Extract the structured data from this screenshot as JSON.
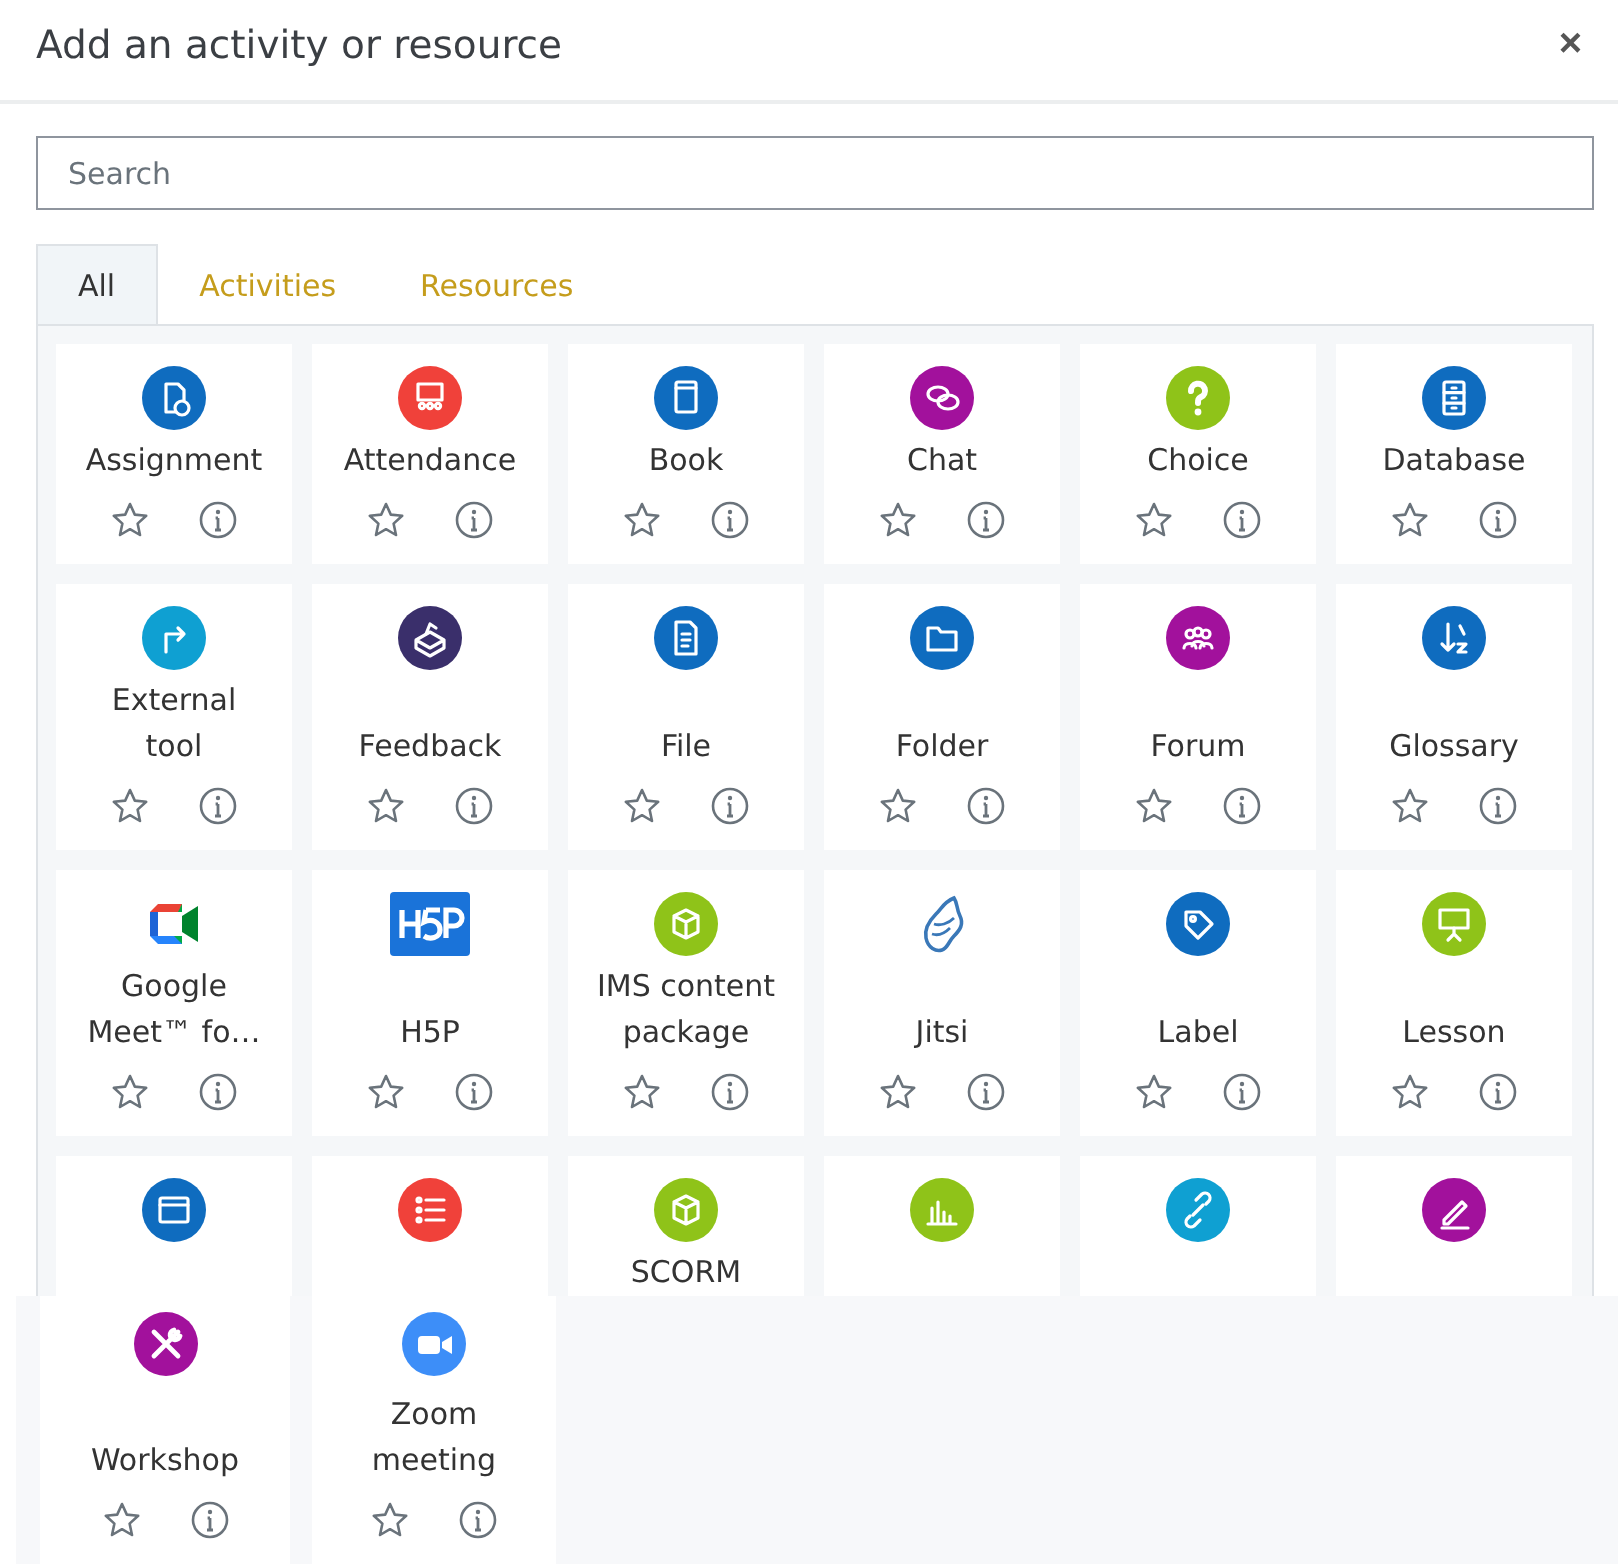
{
  "dialog": {
    "title": "Add an activity or resource",
    "close": "×"
  },
  "search": {
    "placeholder": "Search"
  },
  "tabs": [
    {
      "label": "All",
      "selected": true
    },
    {
      "label": "Activities",
      "selected": false
    },
    {
      "label": "Resources",
      "selected": false
    }
  ],
  "modules": [
    {
      "label": "Assignment",
      "kind": "circle",
      "color": "#0f6cbf"
    },
    {
      "label": "Attendance",
      "kind": "circle",
      "color": "#f0413a"
    },
    {
      "label": "Book",
      "kind": "circle",
      "color": "#0f6cbf"
    },
    {
      "label": "Chat",
      "kind": "circle",
      "color": "#a2119c"
    },
    {
      "label": "Choice",
      "kind": "circle",
      "color": "#8fc319"
    },
    {
      "label": "Database",
      "kind": "circle",
      "color": "#0f6cbf"
    },
    {
      "label": "External\ntool",
      "kind": "circle",
      "color": "#0fa0d2"
    },
    {
      "label": "Feedback",
      "kind": "circle",
      "color": "#3a2f6b"
    },
    {
      "label": "File",
      "kind": "circle",
      "color": "#0f6cbf"
    },
    {
      "label": "Folder",
      "kind": "circle",
      "color": "#0f6cbf"
    },
    {
      "label": "Forum",
      "kind": "circle",
      "color": "#a2119c"
    },
    {
      "label": "Glossary",
      "kind": "circle",
      "color": "#0f6cbf"
    },
    {
      "label": "Google\nMeet™ fo…",
      "kind": "meet"
    },
    {
      "label": "H5P",
      "kind": "h5p"
    },
    {
      "label": "IMS content\npackage",
      "kind": "circle",
      "color": "#8fc319"
    },
    {
      "label": "Jitsi",
      "kind": "jitsi"
    },
    {
      "label": "Label",
      "kind": "circle",
      "color": "#0f6cbf"
    },
    {
      "label": "Lesson",
      "kind": "circle",
      "color": "#8fc319"
    },
    {
      "kind": "circle",
      "color": "#0f6cbf",
      "truncated": true
    },
    {
      "kind": "circle",
      "color": "#f0413a",
      "truncated": true
    },
    {
      "label": "SCORM",
      "kind": "circle",
      "color": "#8fc319",
      "truncated": true
    },
    {
      "kind": "circle",
      "color": "#8fc319",
      "truncated": true
    },
    {
      "kind": "circle",
      "color": "#0fa0d2",
      "truncated": true
    },
    {
      "kind": "circle",
      "color": "#a2119c",
      "truncated": true
    }
  ],
  "continued_modules": [
    {
      "label": "Workshop",
      "kind": "circle",
      "color": "#a2119c"
    },
    {
      "label": "Zoom\nmeeting",
      "kind": "circle",
      "color": "#3d8ef8"
    }
  ]
}
